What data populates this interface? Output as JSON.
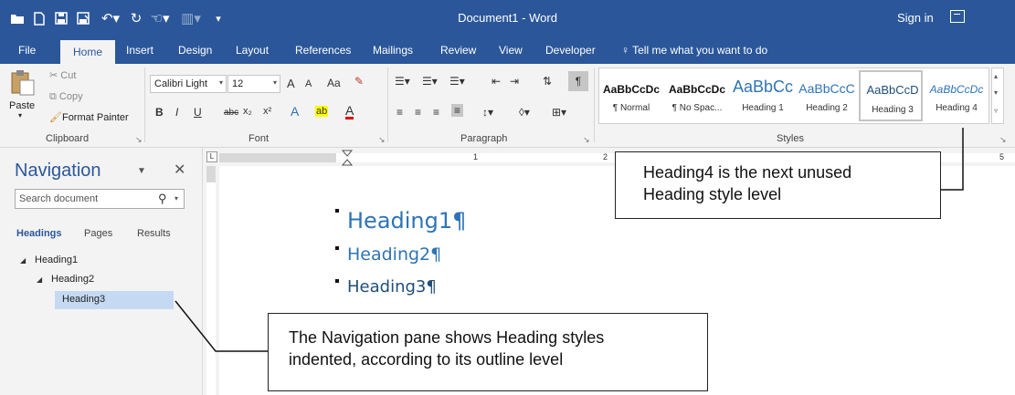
{
  "window": {
    "doc_title": "Document1 - Word",
    "sign_in": "Sign in",
    "qat_icons": [
      "folder-open-icon",
      "new-doc-icon",
      "save-icon",
      "save-as-icon",
      "undo-icon",
      "redo-icon",
      "touch-mode-icon",
      "format-icon",
      "customize-icon"
    ]
  },
  "tabs": [
    "File",
    "Home",
    "Insert",
    "Design",
    "Layout",
    "References",
    "Mailings",
    "Review",
    "View",
    "Developer"
  ],
  "tell_me": "Tell me what you want to do",
  "clipboard": {
    "paste": "Paste",
    "cut": "Cut",
    "copy": "Copy",
    "format_painter": "Format Painter",
    "group_label": "Clipboard"
  },
  "font": {
    "name": "Calibri Light",
    "size": "12",
    "grow": "A",
    "shrink": "A",
    "case": "Aa",
    "bold": "B",
    "italic": "I",
    "underline": "U",
    "strike": "abc",
    "subscript": "x₂",
    "superscript": "x²",
    "effects": "A",
    "highlight": "ab",
    "color": "A",
    "group_label": "Font"
  },
  "paragraph": {
    "group_label": "Paragraph",
    "pilcrow": "¶"
  },
  "styles": {
    "group_label": "Styles",
    "items": [
      {
        "preview": "AaBbCcDc",
        "name": "¶ Normal"
      },
      {
        "preview": "AaBbCcDc",
        "name": "¶ No Spac..."
      },
      {
        "preview": "AaBbCc",
        "name": "Heading 1"
      },
      {
        "preview": "AaBbCcC",
        "name": "Heading 2"
      },
      {
        "preview": "AaBbCcD",
        "name": "Heading 3"
      },
      {
        "preview": "AaBbCcDc",
        "name": "Heading 4"
      }
    ]
  },
  "ruler": {
    "numbers": [
      "1",
      "2",
      "5"
    ]
  },
  "navigation": {
    "title": "Navigation",
    "search_placeholder": "Search document",
    "tabs": [
      "Headings",
      "Pages",
      "Results"
    ],
    "tree": [
      "Heading1",
      "Heading2",
      "Heading3"
    ]
  },
  "document": {
    "headings": [
      "Heading1¶",
      "Heading2¶",
      "Heading3¶"
    ]
  },
  "callouts": {
    "styles_note_line1": "Heading4 is the next unused",
    "styles_note_line2": "Heading style level",
    "nav_note_line1": "The Navigation pane shows Heading styles",
    "nav_note_line2": "indented, according to its outline level"
  },
  "colors": {
    "word_blue": "#2b579a",
    "heading_text": "#2e74b5",
    "selected_tree": "#c5daf2"
  }
}
